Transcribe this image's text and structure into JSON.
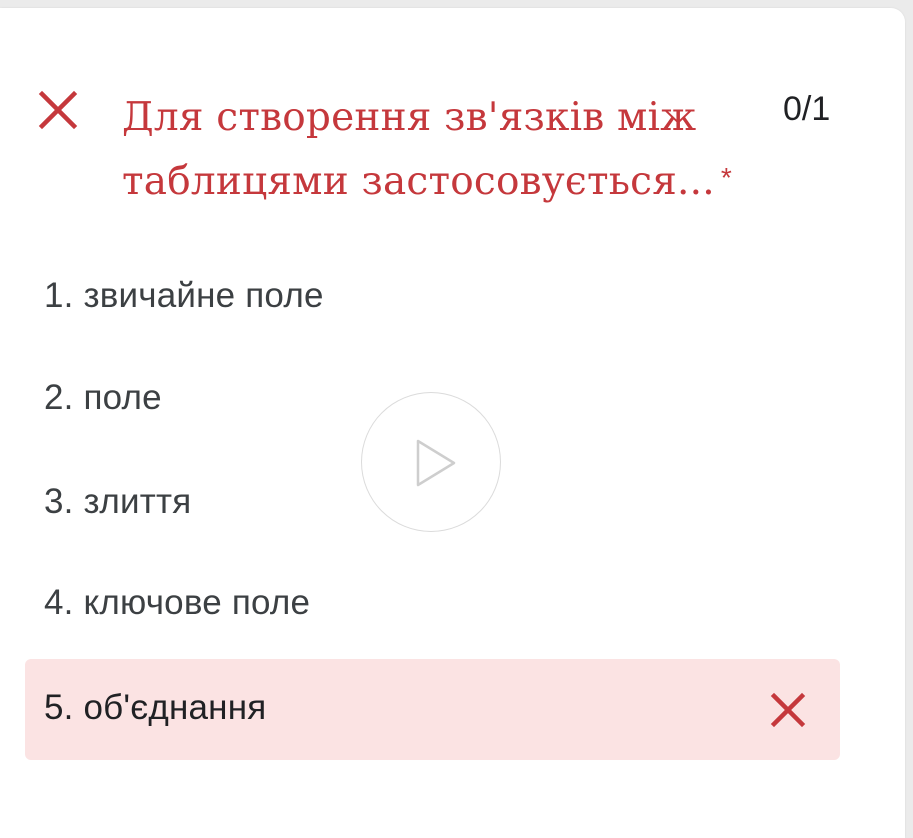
{
  "question": {
    "text": "Для створення зв'язків між таблицями застосовується...",
    "required_marker": "*",
    "score": "0/1",
    "status_icon": "close-icon",
    "status_color": "#c5383c"
  },
  "options": [
    {
      "label": "1. звичайне поле",
      "selected": false
    },
    {
      "label": "2. поле",
      "selected": false
    },
    {
      "label": "3. злиття",
      "selected": false
    },
    {
      "label": "4. ключове поле",
      "selected": false
    },
    {
      "label": "5. об'єднання",
      "selected": true,
      "correct": false,
      "marker_icon": "close-icon"
    }
  ],
  "overlay": {
    "icon": "play-icon"
  },
  "colors": {
    "incorrect_text": "#c5383c",
    "incorrect_bg": "#fbe3e3",
    "page_bg": "#ffffff"
  }
}
